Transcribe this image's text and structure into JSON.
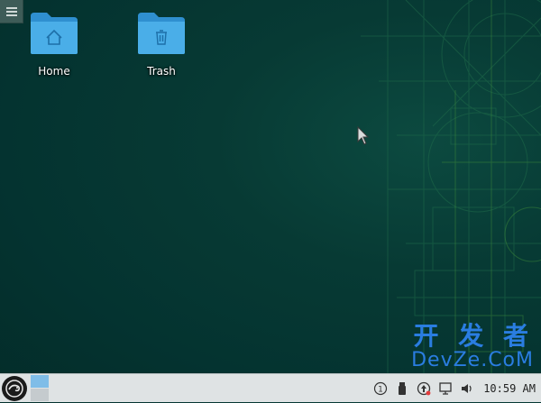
{
  "desktop": {
    "icons": [
      {
        "label": "Home",
        "icon": "home-folder-icon"
      },
      {
        "label": "Trash",
        "icon": "trash-folder-icon"
      }
    ]
  },
  "watermark": {
    "main": "开 发 者",
    "sub_prefix": "DevZe",
    "sub_suffix": ".CoM",
    "accent": "#2a7de1"
  },
  "taskbar": {
    "tray": {
      "updates_badge": "1",
      "clock_partial": "10:59 AM"
    }
  },
  "colors": {
    "folder": "#4aaee8",
    "taskbar": "#dfe3e4",
    "pager_active": "#7fbde8"
  }
}
